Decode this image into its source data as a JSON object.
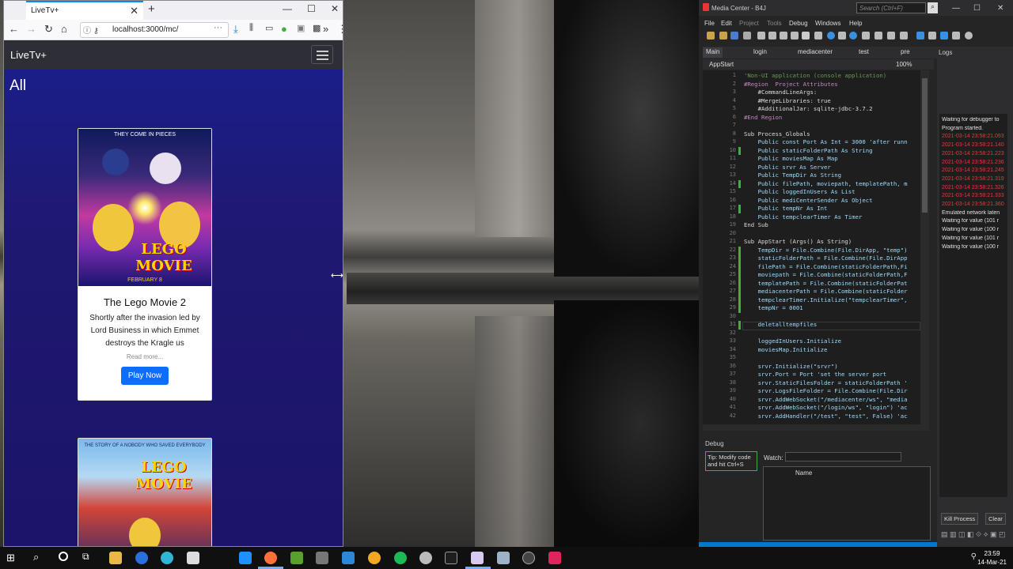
{
  "browser": {
    "tab_title": "LiveTv+",
    "url": "localhost:3000/mc/",
    "page": {
      "brand": "LiveTv+",
      "heading": "All",
      "cards": [
        {
          "poster_tagline": "THEY COME IN PIECES",
          "poster_logo": "LEGO MOVIE",
          "poster_date": "FEBRUARY 8",
          "title": "The Lego Movie 2",
          "description": "Shortly after the invasion led by Lord Business in which Emmet destroys the Kragle us",
          "read_more": "Read more...",
          "button": "Play Now"
        },
        {
          "poster_tagline": "THE STORY OF A NOBODY WHO SAVED EVERYBODY",
          "poster_logo": "LEGO MOVIE"
        }
      ]
    }
  },
  "ide": {
    "title": "Media Center - B4J",
    "search_placeholder": "Search (Ctrl+F)",
    "menu": [
      "File",
      "Edit",
      "Project",
      "Tools",
      "Debug",
      "Windows",
      "Help"
    ],
    "tabs": [
      "Main",
      "login",
      "mediacenter",
      "test",
      "pre"
    ],
    "sub_tab": "AppStart",
    "zoom": "100%",
    "code_lines": [
      {
        "n": "1",
        "t": "'Non-UI application (console application)",
        "c": "#6a9955"
      },
      {
        "n": "2",
        "t": "#Region  Project Attributes",
        "c": "#c586c0"
      },
      {
        "n": "3",
        "t": "    #CommandLineArgs:",
        "c": "#dcdcdc"
      },
      {
        "n": "4",
        "t": "    #MergeLibraries: true",
        "c": "#dcdcdc"
      },
      {
        "n": "5",
        "t": "    #AdditionalJar: sqlite-jdbc-3.7.2",
        "c": "#dcdcdc"
      },
      {
        "n": "6",
        "t": "#End Region",
        "c": "#c586c0"
      },
      {
        "n": "7",
        "t": "",
        "c": "#dcdcdc"
      },
      {
        "n": "8",
        "t": "Sub Process_Globals",
        "c": "#dcdcdc"
      },
      {
        "n": "9",
        "t": "    Public const Port As Int = 3000 'after runn",
        "c": "#9cdcfe"
      },
      {
        "n": "10",
        "t": "    Public staticFolderPath As String",
        "c": "#9cdcfe"
      },
      {
        "n": "11",
        "t": "    Public moviesMap As Map",
        "c": "#9cdcfe"
      },
      {
        "n": "12",
        "t": "    Public srvr As Server",
        "c": "#9cdcfe"
      },
      {
        "n": "13",
        "t": "    Public TempDir As String",
        "c": "#9cdcfe"
      },
      {
        "n": "14",
        "t": "    Public filePath, moviepath, templatePath, m",
        "c": "#9cdcfe"
      },
      {
        "n": "15",
        "t": "    Public loggedInUsers As List",
        "c": "#9cdcfe"
      },
      {
        "n": "16",
        "t": "    Public mediCenterSender As Object",
        "c": "#9cdcfe"
      },
      {
        "n": "17",
        "t": "    Public tempNr As Int",
        "c": "#9cdcfe"
      },
      {
        "n": "18",
        "t": "    Public tempclearTimer As Timer",
        "c": "#9cdcfe"
      },
      {
        "n": "19",
        "t": "End Sub",
        "c": "#dcdcdc"
      },
      {
        "n": "20",
        "t": "",
        "c": "#dcdcdc"
      },
      {
        "n": "21",
        "t": "Sub AppStart (Args() As String)",
        "c": "#dcdcdc"
      },
      {
        "n": "22",
        "t": "    TempDir = File.Combine(File.DirApp, \"temp\")",
        "c": "#9cdcfe"
      },
      {
        "n": "23",
        "t": "    staticFolderPath = File.Combine(File.DirApp",
        "c": "#9cdcfe"
      },
      {
        "n": "24",
        "t": "    filePath = File.Combine(staticFolderPath,Fi",
        "c": "#9cdcfe"
      },
      {
        "n": "25",
        "t": "    moviepath = File.Combine(staticFolderPath,F",
        "c": "#9cdcfe"
      },
      {
        "n": "26",
        "t": "    templatePath = File.Combine(staticFolderPat",
        "c": "#9cdcfe"
      },
      {
        "n": "27",
        "t": "    mediacenterPath = File.Combine(staticFolder",
        "c": "#9cdcfe"
      },
      {
        "n": "28",
        "t": "    tempclearTimer.Initialize(\"tempclearTimer\",",
        "c": "#9cdcfe"
      },
      {
        "n": "29",
        "t": "    tempNr = 0001",
        "c": "#9cdcfe"
      },
      {
        "n": "30",
        "t": "",
        "c": "#dcdcdc"
      },
      {
        "n": "31",
        "t": "    deletalltempfiles",
        "c": "#9cdcfe"
      },
      {
        "n": "32",
        "t": "",
        "c": "#dcdcdc"
      },
      {
        "n": "33",
        "t": "    loggedInUsers.Initialize",
        "c": "#9cdcfe"
      },
      {
        "n": "34",
        "t": "    moviesMap.Initialize",
        "c": "#9cdcfe"
      },
      {
        "n": "35",
        "t": "",
        "c": "#dcdcdc"
      },
      {
        "n": "36",
        "t": "    srvr.Initialize(\"srvr\")",
        "c": "#9cdcfe"
      },
      {
        "n": "37",
        "t": "    srvr.Port = Port 'set the server port",
        "c": "#9cdcfe"
      },
      {
        "n": "38",
        "t": "    srvr.StaticFilesFolder = staticFolderPath '",
        "c": "#9cdcfe"
      },
      {
        "n": "39",
        "t": "    srvr.LogsFileFolder = File.Combine(File.Dir",
        "c": "#9cdcfe"
      },
      {
        "n": "40",
        "t": "    srvr.AddWebSocket(\"/mediacenter/ws\", \"media",
        "c": "#9cdcfe"
      },
      {
        "n": "41",
        "t": "    srvr.AddWebSocket(\"/login/ws\", \"login\") 'ac",
        "c": "#9cdcfe"
      },
      {
        "n": "42",
        "t": "    srvr.AddHandler(\"/test\", \"test\", False) 'ac",
        "c": "#9cdcfe"
      }
    ],
    "logs": {
      "title": "Logs",
      "lines": [
        {
          "t": "Waiting for debugger to",
          "c": "#e0e0e0"
        },
        {
          "t": "Program started.",
          "c": "#e0e0e0"
        },
        {
          "t": "2021-03-14 23:58:21.093",
          "c": "#e23b3b"
        },
        {
          "t": "2021-03-14 23:58:21.140",
          "c": "#e23b3b"
        },
        {
          "t": "2021-03-14 23:58:21.223",
          "c": "#e23b3b"
        },
        {
          "t": "2021-03-14 23:58:21.236",
          "c": "#e23b3b"
        },
        {
          "t": "2021-03-14 23:58:21.245",
          "c": "#e23b3b"
        },
        {
          "t": "2021-03-14 23:58:21.319",
          "c": "#e23b3b"
        },
        {
          "t": "2021-03-14 23:58:21.326",
          "c": "#e23b3b"
        },
        {
          "t": "2021-03-14 23:58:21.333",
          "c": "#e23b3b"
        },
        {
          "t": "2021-03-14 23:58:21.360",
          "c": "#e23b3b"
        },
        {
          "t": "Emulated network laten",
          "c": "#e0e0e0"
        },
        {
          "t": "Waiting for value (101 r",
          "c": "#e0e0e0"
        },
        {
          "t": "Waiting for value (100 r",
          "c": "#e0e0e0"
        },
        {
          "t": "Waiting for value (101 r",
          "c": "#e0e0e0"
        },
        {
          "t": "Waiting for value (100 r",
          "c": "#e0e0e0"
        }
      ],
      "kill_button": "Kill Process",
      "clear_button": "Clear"
    },
    "debug": {
      "title": "Debug",
      "tip": "Tip: Modify code and hit Ctrl+S",
      "watch_label": "Watch:",
      "column_name": "Name"
    }
  },
  "taskbar": {
    "time": "23:59",
    "date": "14-Mar-21"
  }
}
